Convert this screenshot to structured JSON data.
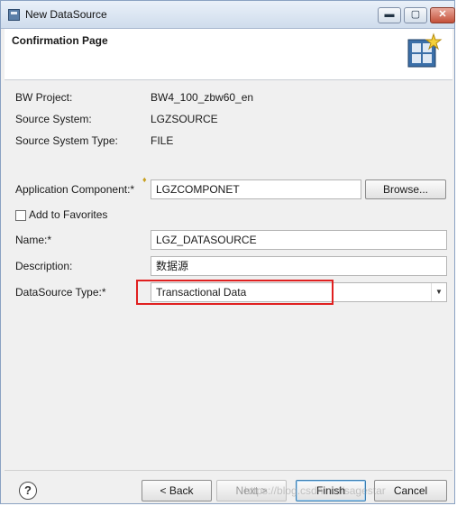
{
  "window": {
    "title": "New DataSource",
    "minimize_glyph": "▬",
    "maximize_glyph": "▢",
    "close_glyph": "✕"
  },
  "header": {
    "title": "Confirmation Page",
    "icon": "datasource-wizard-icon"
  },
  "info": {
    "bw_project_label": "BW Project:",
    "bw_project_value": "BW4_100_zbw60_en",
    "source_system_label": "Source System:",
    "source_system_value": "LGZSOURCE",
    "source_system_type_label": "Source System Type:",
    "source_system_type_value": "FILE"
  },
  "form": {
    "application_component_label": "Application Component:*",
    "application_component_value": "LGZCOMPONET",
    "browse_label": "Browse...",
    "add_to_favorites_label": "Add to Favorites",
    "add_to_favorites_checked": false,
    "name_label": "Name:*",
    "name_value": "LGZ_DATASOURCE",
    "description_label": "Description:",
    "description_value": "数据源",
    "datasource_type_label": "DataSource Type:*",
    "datasource_type_value": "Transactional Data"
  },
  "footer": {
    "help_glyph": "?",
    "back_label": "< Back",
    "next_label": "Next >",
    "finish_label": "Finish",
    "cancel_label": "Cancel",
    "watermark": "https://blog.csdn.net/sagestar"
  },
  "colors": {
    "highlight_border": "#e02020",
    "title_gradient_top": "#e9f0f9",
    "close_button": "#c4513a"
  }
}
